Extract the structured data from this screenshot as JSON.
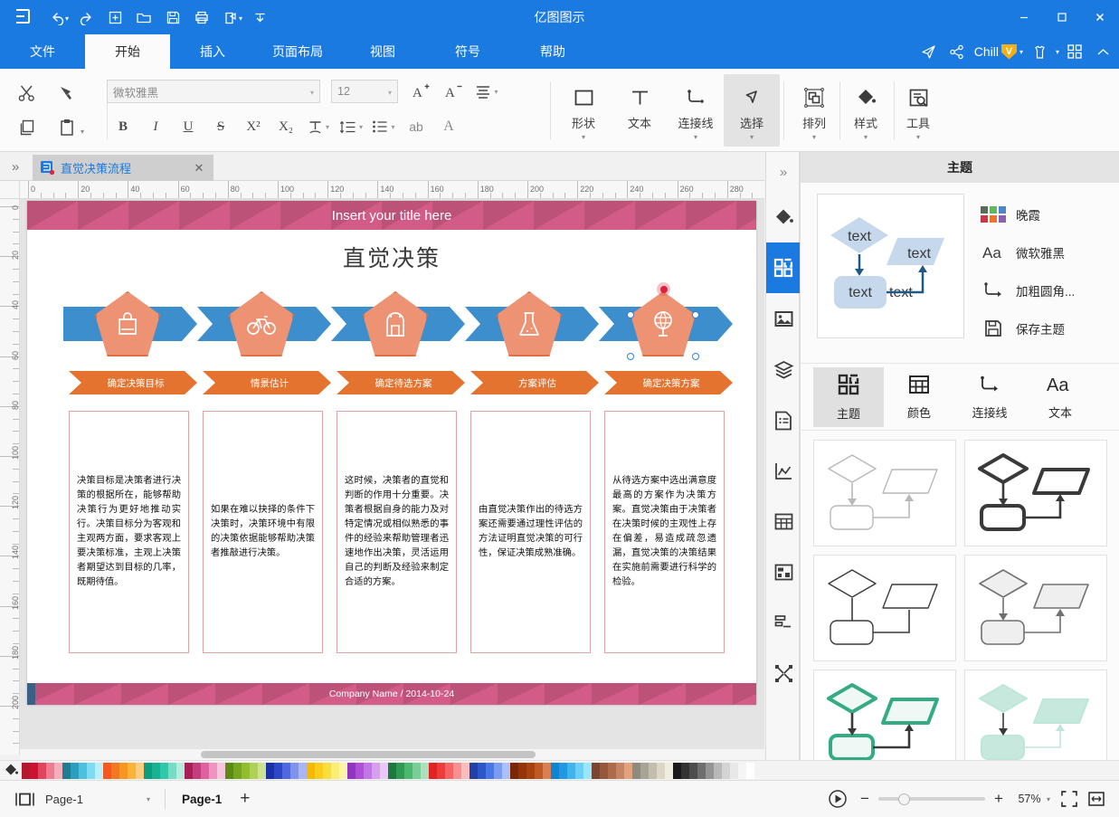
{
  "window": {
    "title": "亿图图示",
    "minimize": "–",
    "maximize": "□",
    "close": "✕"
  },
  "quick_access": [
    {
      "name": "undo-icon",
      "label": "撤销"
    },
    {
      "name": "redo-icon",
      "label": "重做"
    },
    {
      "name": "new-icon",
      "label": "新建"
    },
    {
      "name": "open-icon",
      "label": "打开"
    },
    {
      "name": "save-icon",
      "label": "保存"
    },
    {
      "name": "print-icon",
      "label": "打印"
    },
    {
      "name": "export-icon",
      "label": "导出"
    },
    {
      "name": "customize-icon",
      "label": "自定义"
    }
  ],
  "menu": {
    "tabs": [
      {
        "label": "文件",
        "active": false
      },
      {
        "label": "开始",
        "active": true
      },
      {
        "label": "插入",
        "active": false
      },
      {
        "label": "页面布局",
        "active": false
      },
      {
        "label": "视图",
        "active": false
      },
      {
        "label": "符号",
        "active": false
      },
      {
        "label": "帮助",
        "active": false
      }
    ],
    "right": {
      "send_icon": "send-icon",
      "share_icon": "share-icon",
      "account_name": "Chill",
      "vip_badge": "V",
      "skin_icon": "skin-icon",
      "apps_icon": "apps-grid-icon",
      "collapse_icon": "collapse-ribbon-icon"
    }
  },
  "ribbon": {
    "clipboard": {
      "cut": "剪切",
      "format_painter": "格式刷",
      "copy": "复制",
      "paste": "粘贴"
    },
    "font": {
      "family_value": "微软雅黑",
      "size_value": "12",
      "grow": "A⁺",
      "shrink": "A⁻",
      "align": "对齐",
      "bold": "B",
      "italic": "I",
      "underline": "U",
      "strikethrough": "S",
      "superscript": "X²",
      "subscript": "X₂",
      "text_style": "T",
      "line_spacing": "行距",
      "bullets": "项目符号",
      "text_wrap": "ab",
      "font_color": "A"
    },
    "tools": [
      {
        "label": "形状",
        "icon": "square-icon",
        "caret": true,
        "active": false
      },
      {
        "label": "文本",
        "icon": "text-icon",
        "caret": false,
        "active": false
      },
      {
        "label": "连接线",
        "icon": "connector-icon",
        "caret": true,
        "active": false
      },
      {
        "label": "选择",
        "icon": "pointer-icon",
        "caret": true,
        "active": true
      }
    ],
    "tools2": [
      {
        "label": "排列",
        "icon": "arrange-icon",
        "caret": true
      },
      {
        "label": "样式",
        "icon": "fill-bucket-icon",
        "caret": true
      },
      {
        "label": "工具",
        "icon": "tools-icon",
        "caret": true
      }
    ]
  },
  "doc_tab": {
    "expand_icon": "chevron-double-right-icon",
    "file_icon": "edraw-file-icon",
    "title": "直觉决策流程",
    "close": "✕"
  },
  "rulers": {
    "horizontal": [
      "0",
      "20",
      "40",
      "60",
      "80",
      "100",
      "120",
      "140",
      "160",
      "180",
      "200",
      "220",
      "240",
      "260",
      "280"
    ],
    "vertical": [
      "0",
      "20",
      "40",
      "60",
      "80",
      "100",
      "120",
      "140",
      "160",
      "180",
      "200"
    ]
  },
  "document": {
    "header_title": "Insert your title here",
    "main_title": "直觉决策",
    "footer_title": "Company Name / 2014-10-24",
    "steps": [
      {
        "icon": "shopping-bag-icon",
        "label": "确定决策目标",
        "text": "决策目标是决策者进行决策的根据所在，能够帮助决策行为更好地推动实行。决策目标分为客观和主观两方面，要求客观上要决策标准，主观上决策者期望达到目标的几率，既期待值。"
      },
      {
        "icon": "bicycle-icon",
        "label": "情景估计",
        "text": "如果在难以抉择的条件下决策时，决策环境中有限的决策依据能够帮助决策者推敲进行决策。"
      },
      {
        "icon": "backpack-icon",
        "label": "确定待选方案",
        "text": "这时候，决策者的直觉和判断的作用十分重要。决策者根据自身的能力及对特定情况或相似熟悉的事件的经验来帮助管理者迅速地作出决策，灵活运用自己的判断及经验来制定合适的方案。"
      },
      {
        "icon": "flask-icon",
        "label": "方案评估",
        "text": "由直觉决策作出的待选方案还需要通过理性评估的方法证明直觉决策的可行性，保证决策成熟准确。"
      },
      {
        "icon": "globe-icon",
        "label": "确定决策方案",
        "text": "从待选方案中选出满意度最高的方案作为决策方案。直觉决策由于决策者在决策时候的主观性上存在偏差，易造成疏忽遗漏，直觉决策的决策结果在实施前需要进行科学的检验。"
      }
    ],
    "colors": {
      "header_pink": "#d25b87",
      "arrow_blue": "#3d8ecc",
      "pentagon_fill": "#ed9273",
      "pentagon_stroke": "#e0703f",
      "chevron_orange": "#e3732e",
      "textbox_border": "#e0a6a6"
    }
  },
  "rail": [
    {
      "name": "expand-panel-icon",
      "label": "展开",
      "active": false
    },
    {
      "name": "fill-style-icon",
      "label": "填充样式",
      "active": false
    },
    {
      "name": "theme-grid-icon",
      "label": "主题",
      "active": true
    },
    {
      "name": "image-icon",
      "label": "图片",
      "active": false
    },
    {
      "name": "layers-icon",
      "label": "图层",
      "active": false
    },
    {
      "name": "document-list-icon",
      "label": "文档",
      "active": false
    },
    {
      "name": "chart-icon",
      "label": "图表",
      "active": false
    },
    {
      "name": "table-icon",
      "label": "表格",
      "active": false
    },
    {
      "name": "gantt-icon",
      "label": "甘特图",
      "active": false
    },
    {
      "name": "mindmap-icon",
      "label": "结构图",
      "active": false
    },
    {
      "name": "network-icon",
      "label": "网络图",
      "active": false
    }
  ],
  "theme_panel": {
    "title": "主题",
    "preview": {
      "node1": "text",
      "node2": "text",
      "node3": "text",
      "node4": "text"
    },
    "meta": [
      {
        "icon": "color-swatches-icon",
        "label": "晚霞"
      },
      {
        "icon": "font-aa-icon",
        "label": "微软雅黑"
      },
      {
        "icon": "connector-style-icon",
        "label": "加粗圆角..."
      },
      {
        "icon": "save-icon",
        "label": "保存主题"
      }
    ],
    "subtabs": [
      {
        "label": "主题",
        "icon": "theme-grid-icon",
        "active": true
      },
      {
        "label": "颜色",
        "icon": "color-table-icon",
        "active": false
      },
      {
        "label": "连接线",
        "icon": "connector-icon",
        "active": false
      },
      {
        "label": "文本",
        "icon": "font-aa-icon",
        "active": false
      }
    ],
    "cards": [
      {
        "name": "theme-card-light-thin",
        "stroke": "#b9b9b9",
        "fill": "#ffffff",
        "width": 1.4
      },
      {
        "name": "theme-card-bold-dark",
        "stroke": "#3a3a3a",
        "fill": "#ffffff",
        "width": 4
      },
      {
        "name": "theme-card-plain-noarrow",
        "stroke": "#3a3a3a",
        "fill": "#ffffff",
        "width": 1.4
      },
      {
        "name": "theme-card-gray-fill",
        "stroke": "#707070",
        "fill": "#efefef",
        "width": 1.6
      },
      {
        "name": "theme-card-green-outline",
        "stroke": "#34ab84",
        "fill": "#eef9f5",
        "width": 4
      },
      {
        "name": "theme-card-green-solid",
        "stroke": "#bfe6da",
        "fill": "#c6e8dd",
        "width": 2
      }
    ]
  },
  "color_palette": {
    "bucket_icon": "fill-bucket-icon",
    "swatches": [
      "#b5172f",
      "#cf1134",
      "#e0455f",
      "#ee7b90",
      "#f4adba",
      "#1d7d93",
      "#2e9ec0",
      "#4cc0dd",
      "#7ddcf2",
      "#b9eefb",
      "#f2591f",
      "#f47820",
      "#f79422",
      "#fab237",
      "#fccd7d",
      "#0c9c7e",
      "#17b393",
      "#2fc9a9",
      "#77dcc5",
      "#b6ebdd",
      "#a81e55",
      "#c53d7e",
      "#de62a0",
      "#ef93c0",
      "#f8c5de",
      "#5d8b11",
      "#76a520",
      "#92bd2c",
      "#aed158",
      "#cde392",
      "#1b31a8",
      "#2c47c8",
      "#4f68e0",
      "#7f92ec",
      "#aab6f4",
      "#f5b800",
      "#f9cd1b",
      "#fade3e",
      "#fced73",
      "#fdf4a8",
      "#9333c2",
      "#af4fd8",
      "#c275e6",
      "#d6a0ef",
      "#e8c8f6",
      "#1d7a3e",
      "#2f9a53",
      "#4cb76e",
      "#7bcd96",
      "#abe2bd",
      "#e02424",
      "#ef3b3b",
      "#f46464",
      "#f89090",
      "#fbbcbc",
      "#1f41a8",
      "#2d57c8",
      "#4a77e8",
      "#7a9bf2",
      "#a9c0f8",
      "#7a2704",
      "#953408",
      "#a8430f",
      "#bf5a27",
      "#d97f50",
      "#0f84cf",
      "#2199e0",
      "#3fb4ef",
      "#6bd0f8",
      "#9be6fd",
      "#7a4530",
      "#94583e",
      "#ad6b4c",
      "#c78462",
      "#e1a27e",
      "#8f8a80",
      "#a9a396",
      "#c3bdae",
      "#dcd6c7",
      "#f0ece0",
      "#1a1a1a",
      "#333333",
      "#4d4d4d",
      "#6e6e6e",
      "#949494",
      "#b8b8b8",
      "#d4d4d4",
      "#e8e8e8",
      "#f5f5f5",
      "#ffffff"
    ]
  },
  "status_bar": {
    "view_icon": "page-view-icon",
    "page_select": "Page-1",
    "page_tab": "Page-1",
    "add_page": "+",
    "play_icon": "present-icon",
    "zoom_out": "−",
    "zoom_in": "+",
    "zoom_value": "57%",
    "fit_page_icon": "fit-page-icon",
    "fit_width_icon": "fit-width-icon"
  }
}
